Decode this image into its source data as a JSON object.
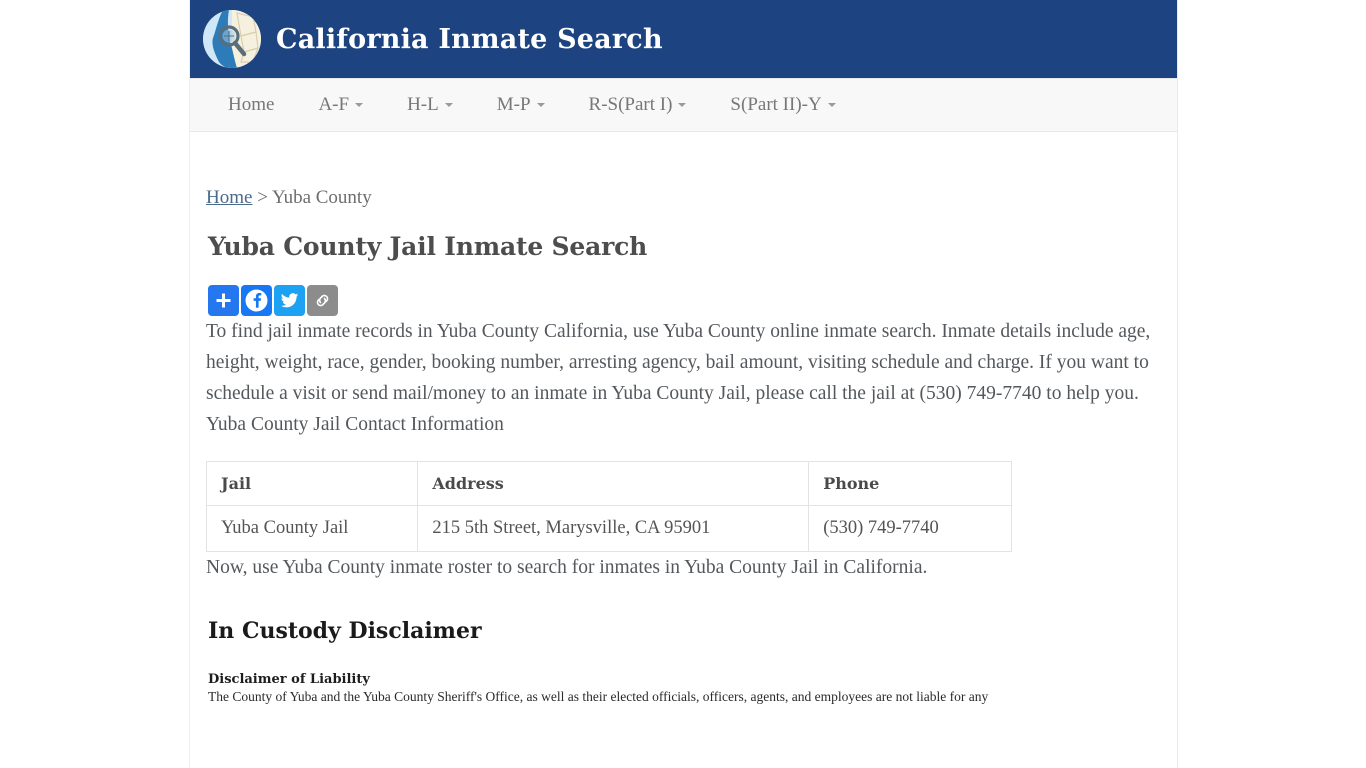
{
  "header": {
    "title": "California Inmate Search",
    "logo_icon": "california-map-magnifier-icon",
    "background_color": "#1d4481"
  },
  "nav": {
    "items": [
      {
        "label": "Home",
        "has_dropdown": false
      },
      {
        "label": "A-F",
        "has_dropdown": true
      },
      {
        "label": "H-L",
        "has_dropdown": true
      },
      {
        "label": "M-P",
        "has_dropdown": true
      },
      {
        "label": "R-S(Part I)",
        "has_dropdown": true
      },
      {
        "label": "S(Part II)-Y",
        "has_dropdown": true
      }
    ]
  },
  "breadcrumb": {
    "home_label": "Home",
    "separator": " > ",
    "current": "Yuba County"
  },
  "main": {
    "page_title": "Yuba County Jail Inmate Search",
    "intro_paragraph": "To find jail inmate records in Yuba County California, use Yuba County online inmate search. Inmate details include age, height, weight, race, gender, booking number, arresting agency, bail amount, visiting schedule and charge. If you want to schedule a visit or send mail/money to an inmate in Yuba County Jail, please call the jail at (530) 749-7740 to help you.",
    "contact_label": "Yuba County Jail Contact Information",
    "roster_paragraph": "Now, use Yuba County inmate roster to search for inmates in Yuba County Jail in California.",
    "disclaimer_heading": "In Custody Disclaimer",
    "disclaimer_subheading": "Disclaimer of Liability",
    "disclaimer_body": "The County of Yuba and the Yuba County Sheriff's Office, as well as their elected officials, officers, agents, and employees are not liable for any"
  },
  "share": {
    "buttons": [
      {
        "name": "addthis-share-button",
        "icon": "plus-icon",
        "color": "#2577ef"
      },
      {
        "name": "facebook-share-button",
        "icon": "facebook-icon",
        "color": "#1877f2"
      },
      {
        "name": "twitter-share-button",
        "icon": "twitter-icon",
        "color": "#1da1f2"
      },
      {
        "name": "copy-link-button",
        "icon": "link-chain-icon",
        "color": "#8c8c8c"
      }
    ]
  },
  "contact_table": {
    "headers": [
      "Jail",
      "Address",
      "Phone"
    ],
    "rows": [
      [
        "Yuba County Jail",
        "215 5th Street, Marysville, CA 95901",
        "(530) 749-7740"
      ]
    ]
  }
}
